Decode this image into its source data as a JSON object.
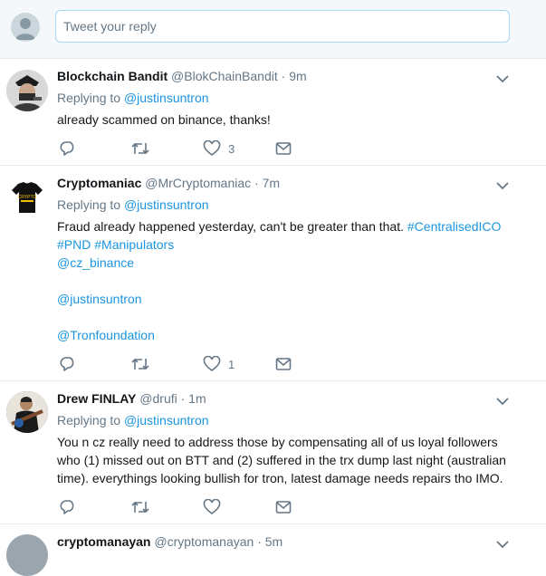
{
  "reply_bar": {
    "placeholder": "Tweet your reply"
  },
  "tweets": [
    {
      "name": "Blockchain Bandit",
      "handle": "@BlokChainBandit",
      "time": "· 9m",
      "replying_prefix": "Replying to",
      "replying_to": "@justinsuntron",
      "text": "already scammed on binance,  thanks!",
      "like_count": "3"
    },
    {
      "name": "Cryptomaniac",
      "handle": "@MrCryptomaniac",
      "time": "· 7m",
      "replying_prefix": "Replying to",
      "replying_to": "@justinsuntron",
      "text_line1": "Fraud already happened yesterday, can't be greater than that.",
      "hashtag1": "#CentralisedICO",
      "hashtag2": "#PND",
      "hashtag3": "#Manipulators",
      "mention1": "@cz_binance",
      "mention2": "@justinsuntron",
      "mention3": "@Tronfoundation",
      "like_count": "1",
      "avatar_logo": "CRYPTO"
    },
    {
      "name": "Drew FINLAY",
      "handle": "@drufi",
      "time": "· 1m",
      "replying_prefix": "Replying to",
      "replying_to": "@justinsuntron",
      "text": "You n cz really need to address  those by compensating all of us loyal followers who (1) missed out on BTT and (2) suffered in the trx dump last night (australian time). everythings looking bullish for tron, latest damage needs repairs tho IMO."
    },
    {
      "name": "cryptomanayan",
      "handle": "@cryptomanayan",
      "time": "· 5m"
    }
  ],
  "icons": {
    "reply": "reply-icon",
    "retweet": "retweet-icon",
    "like": "heart-icon",
    "message": "direct-message-icon",
    "more": "chevron-down-icon"
  },
  "colors": {
    "link": "#1b95e0",
    "muted": "#657786",
    "divider": "#e6ecf0"
  }
}
